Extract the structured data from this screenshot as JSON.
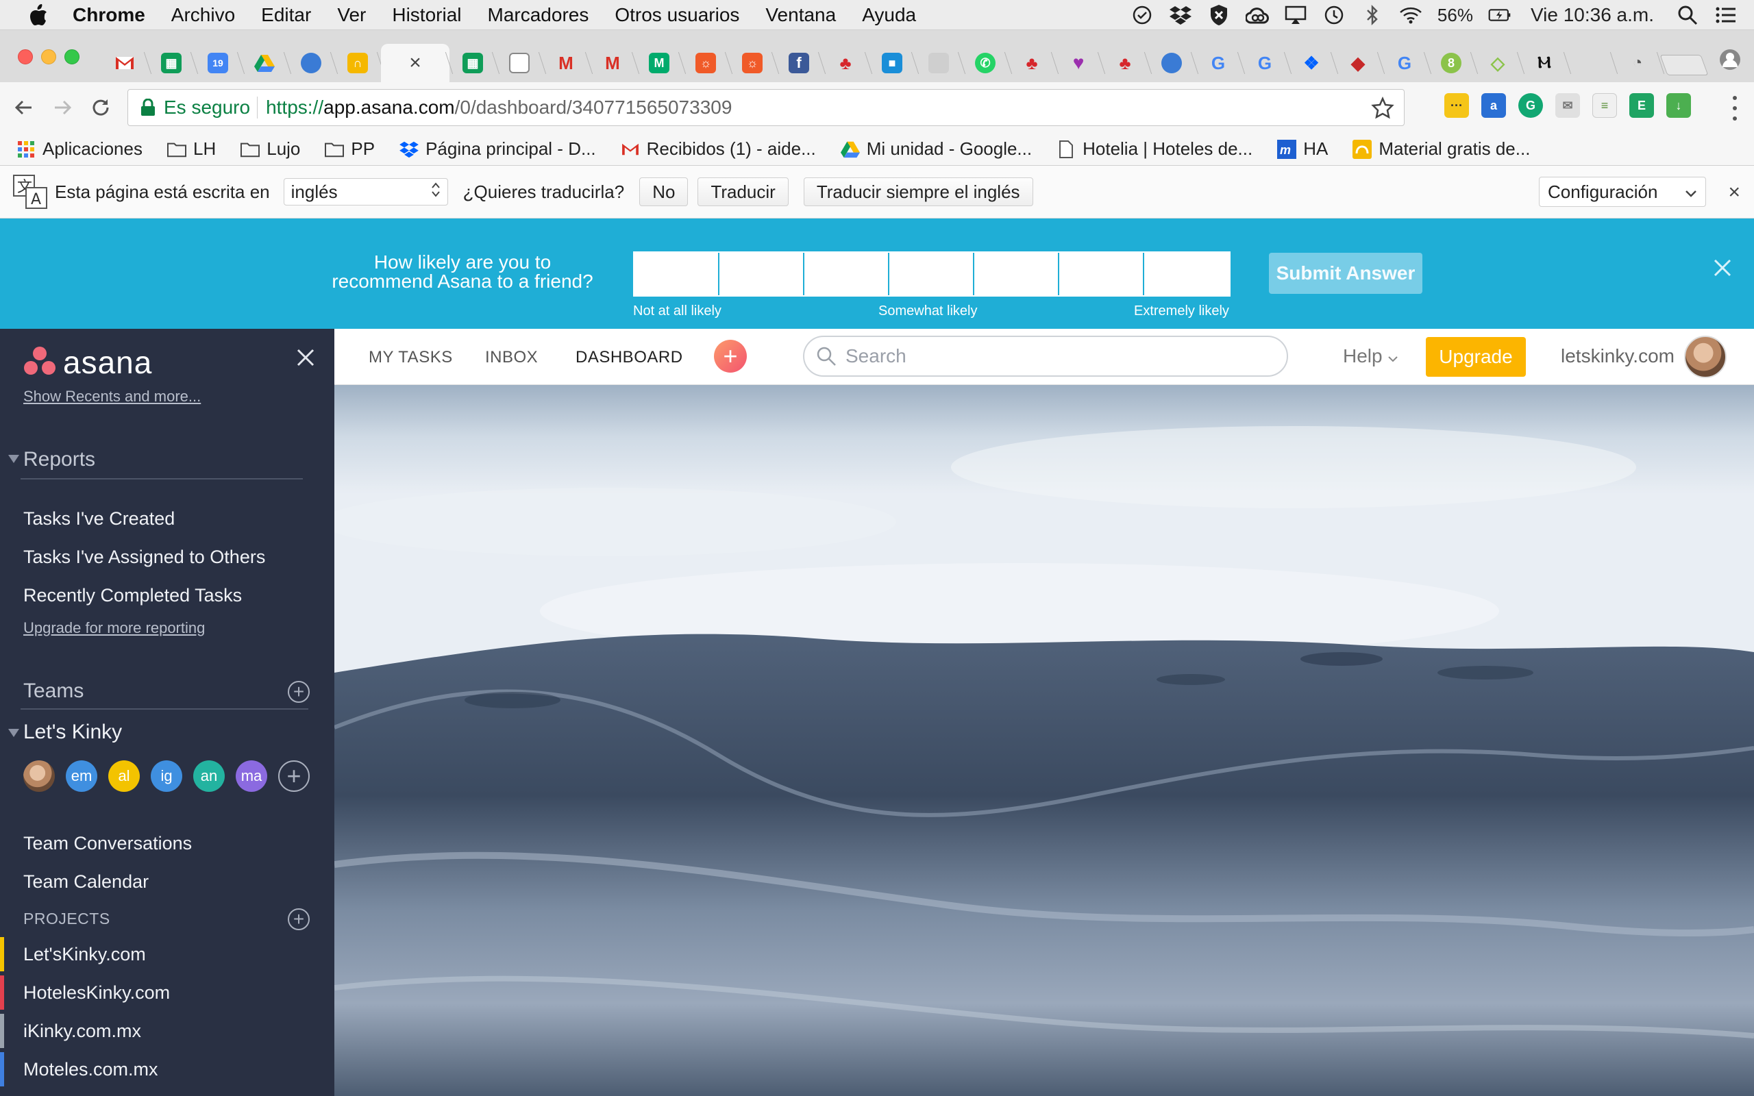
{
  "menubar": {
    "app": "Chrome",
    "items": [
      "Archivo",
      "Editar",
      "Ver",
      "Historial",
      "Marcadores",
      "Otros usuarios",
      "Ventana",
      "Ayuda"
    ],
    "battery": "56%",
    "clock": "Vie 10:36 a.m."
  },
  "browser": {
    "omnibox": {
      "secure_label": "Es seguro",
      "url_proto": "https://",
      "url_host": "app.asana.com",
      "url_path": "/0/dashboard/340771565073309"
    },
    "bookmarks": [
      {
        "label": "Aplicaciones",
        "icon": "apps-grid-icon"
      },
      {
        "label": "LH",
        "icon": "folder-icon"
      },
      {
        "label": "Lujo",
        "icon": "folder-icon"
      },
      {
        "label": "PP",
        "icon": "folder-icon"
      },
      {
        "label": "Página principal - D...",
        "icon": "dropbox-icon"
      },
      {
        "label": "Recibidos (1) - aide...",
        "icon": "gmail-icon"
      },
      {
        "label": "Mi unidad - Google...",
        "icon": "drive-icon"
      },
      {
        "label": "Hotelia | Hoteles de...",
        "icon": "page-icon"
      },
      {
        "label": "HA",
        "icon": "m-icon"
      },
      {
        "label": "Material gratis de...",
        "icon": "yellow-icon"
      }
    ]
  },
  "translate": {
    "prompt": "Esta página está escrita en",
    "language": "inglés",
    "question": "¿Quieres traducirla?",
    "no": "No",
    "translate": "Traducir",
    "always": "Traducir siempre el inglés",
    "config": "Configuración"
  },
  "survey": {
    "question": "How likely are you to recommend Asana to a friend?",
    "scale_count": 7,
    "label_low": "Not at all likely",
    "label_mid": "Somewhat likely",
    "label_high": "Extremely likely",
    "submit": "Submit Answer"
  },
  "sidebar": {
    "logo_text": "asana",
    "show_recents": "Show Recents and more...",
    "reports": {
      "title": "Reports",
      "items": [
        "Tasks I've Created",
        "Tasks I've Assigned to Others",
        "Recently Completed Tasks"
      ],
      "upgrade": "Upgrade for more reporting"
    },
    "teams_title": "Teams",
    "team": {
      "name": "Let's Kinky",
      "members": [
        {
          "initials": "",
          "color": "#c9a080"
        },
        {
          "initials": "em",
          "color": "#3f8fe0"
        },
        {
          "initials": "al",
          "color": "#f3c300"
        },
        {
          "initials": "ig",
          "color": "#3f8fe0"
        },
        {
          "initials": "an",
          "color": "#23b3a0"
        },
        {
          "initials": "ma",
          "color": "#8b6ae0"
        }
      ],
      "links": [
        "Team Conversations",
        "Team Calendar"
      ]
    },
    "projects_title": "PROJECTS",
    "projects": [
      {
        "name": "Let'sKinky.com",
        "color": "#f5c400"
      },
      {
        "name": "HotelesKinky.com",
        "color": "#e3404e"
      },
      {
        "name": "iKinky.com.mx",
        "color": "#9aa3ae"
      },
      {
        "name": "Moteles.com.mx",
        "color": "#3f7fe0"
      }
    ]
  },
  "topbar": {
    "nav": [
      "MY TASKS",
      "INBOX",
      "DASHBOARD"
    ],
    "active": "DASHBOARD",
    "search_placeholder": "Search",
    "help": "Help",
    "upgrade": "Upgrade",
    "workspace": "letskinky.com"
  },
  "colors": {
    "asana_sidebar": "#293043",
    "survey_blue": "#1faed6",
    "upgrade_yellow": "#fcb500",
    "secure_green": "#0b8043"
  }
}
